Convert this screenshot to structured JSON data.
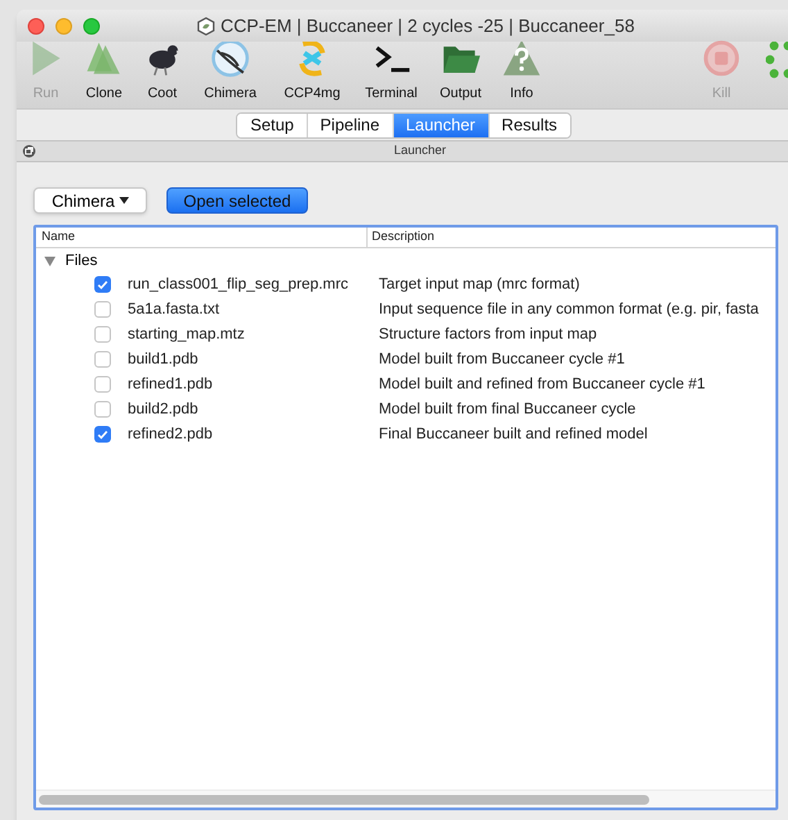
{
  "window": {
    "title": "CCP-EM | Buccaneer | 2 cycles -25 | Buccaneer_58"
  },
  "toolbar": {
    "tools": [
      {
        "kind": "run",
        "label": "Run",
        "disabled": true
      },
      {
        "kind": "clone",
        "label": "Clone",
        "disabled": false
      },
      {
        "kind": "coot",
        "label": "Coot",
        "disabled": false
      },
      {
        "kind": "chimera",
        "label": "Chimera",
        "disabled": false
      },
      {
        "kind": "ccp4mg",
        "label": "CCP4mg",
        "disabled": false
      },
      {
        "kind": "terminal",
        "label": "Terminal",
        "disabled": false
      },
      {
        "kind": "output",
        "label": "Output",
        "disabled": false
      },
      {
        "kind": "info",
        "label": "Info",
        "disabled": false
      }
    ],
    "right_tools": [
      {
        "kind": "kill",
        "label": "Kill",
        "disabled": true
      }
    ]
  },
  "tabs": [
    {
      "label": "Setup",
      "selected": false
    },
    {
      "label": "Pipeline",
      "selected": false
    },
    {
      "label": "Launcher",
      "selected": true
    },
    {
      "label": "Results",
      "selected": false
    }
  ],
  "panel": {
    "title": "Launcher"
  },
  "program_dropdown": {
    "value": "Chimera"
  },
  "open_button": {
    "label": "Open selected"
  },
  "table": {
    "columns": [
      "Name",
      "Description"
    ],
    "group": {
      "label": "Files",
      "expanded": true,
      "children": [
        {
          "name": "run_class001_flip_seg_prep.mrc",
          "description": "Target input map (mrc format)",
          "checked": true
        },
        {
          "name": "5a1a.fasta.txt",
          "description": "Input sequence file in any common format (e.g. pir, fasta",
          "checked": false
        },
        {
          "name": "starting_map.mtz",
          "description": "Structure factors from input map",
          "checked": false
        },
        {
          "name": "build1.pdb",
          "description": "Model built from Buccaneer cycle #1",
          "checked": false
        },
        {
          "name": "refined1.pdb",
          "description": "Model built and refined from Buccaneer cycle #1",
          "checked": false
        },
        {
          "name": "build2.pdb",
          "description": "Model built from final Buccaneer cycle",
          "checked": false
        },
        {
          "name": "refined2.pdb",
          "description": "Final Buccaneer built and refined model",
          "checked": true
        }
      ]
    }
  }
}
